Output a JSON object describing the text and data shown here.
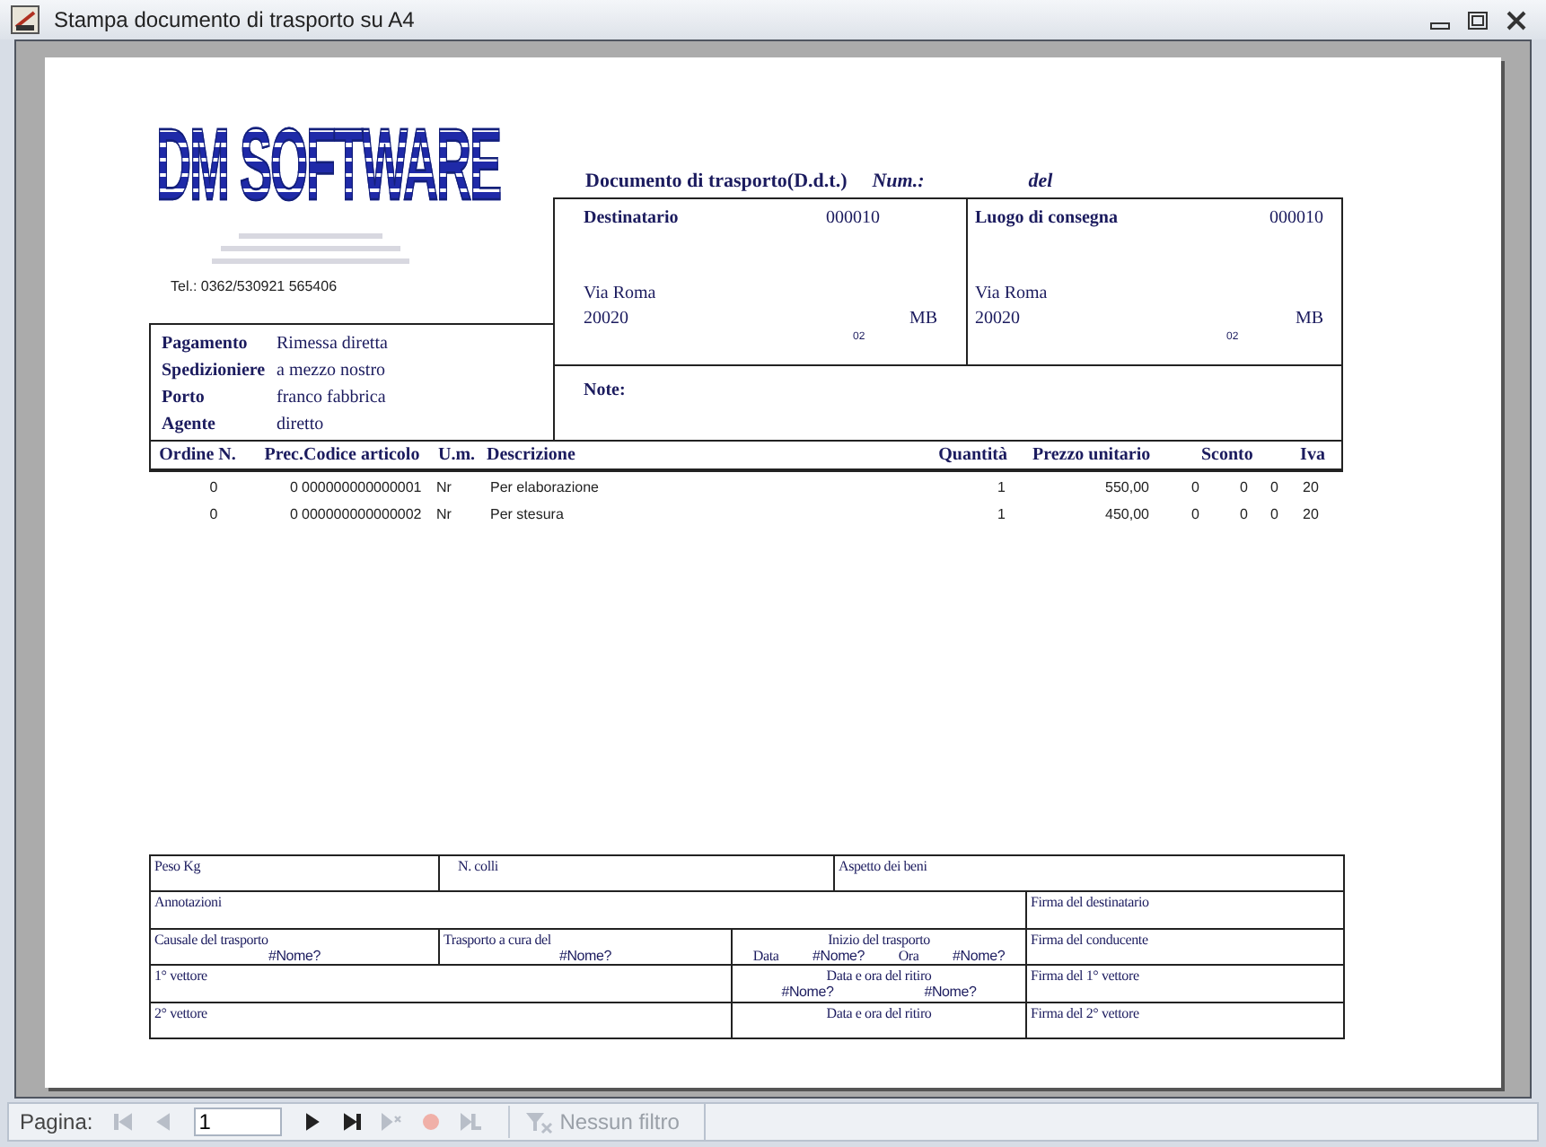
{
  "window": {
    "title": "Stampa documento di trasporto su A4"
  },
  "report": {
    "logo": {
      "name": "DM SOFTWARE",
      "phone": "Tel.: 0362/530921 565406"
    },
    "heading": {
      "title": "Documento di trasporto(D.d.t.)",
      "number_label": "Num.:",
      "date_label": "del"
    },
    "addresses": [
      {
        "label": "Destinatario",
        "code": "000010",
        "street": "Via Roma",
        "zip": "20020",
        "province": "MB",
        "extra": "02"
      },
      {
        "label": "Luogo di consegna",
        "code": "000010",
        "street": "Via Roma",
        "zip": "20020",
        "province": "MB",
        "extra": "02"
      }
    ],
    "terms": [
      {
        "label": "Pagamento",
        "value": "Rimessa diretta"
      },
      {
        "label": "Spedizioniere",
        "value": "a mezzo nostro"
      },
      {
        "label": "Porto",
        "value": "franco fabbrica"
      },
      {
        "label": "Agente",
        "value": "diretto"
      }
    ],
    "notes_label": "Note:",
    "items": {
      "columns": [
        "Ordine N.",
        "Prec.",
        "Codice articolo",
        "U.m.",
        "Descrizione",
        "Quantità",
        "Prezzo unitario",
        "",
        "Sconto",
        "",
        "Iva"
      ],
      "rows": [
        [
          "0",
          "0",
          "000000000000001",
          "Nr",
          "Per elaborazione",
          "1",
          "550,00",
          "0",
          "0",
          "0",
          "20"
        ],
        [
          "0",
          "0",
          "000000000000002",
          "Nr",
          "Per stesura",
          "1",
          "450,00",
          "0",
          "0",
          "0",
          "20"
        ]
      ]
    },
    "shipping_box": {
      "rows": [
        [
          {
            "label": "Peso Kg"
          },
          {
            "label": "N. colli",
            "colspan": 2
          },
          {
            "label": "Aspetto dei beni",
            "colspan": 2
          }
        ],
        [
          {
            "label": "Annotazioni",
            "colspan": 4
          },
          {
            "label": "Firma del destinatario"
          }
        ],
        [
          {
            "label": "Causale del trasporto",
            "values": [
              {
                "text": "#Nome?",
                "kind": "value"
              }
            ]
          },
          {
            "label": "Trasporto a cura del",
            "values": [
              {
                "text": "#Nome?",
                "kind": "value"
              }
            ]
          },
          {
            "label": "Inizio del trasporto",
            "colspan": 2,
            "values": [
              {
                "text": "Data",
                "kind": "label"
              },
              {
                "text": "#Nome?",
                "kind": "value"
              },
              {
                "text": "Ora",
                "kind": "label"
              },
              {
                "text": "#Nome?",
                "kind": "value"
              }
            ]
          },
          {
            "label": "Firma del conducente"
          }
        ],
        [
          {
            "label": "1° vettore",
            "colspan": 2
          },
          {
            "label": "Data e ora del ritiro",
            "colspan": 2,
            "values": [
              {
                "text": "#Nome?",
                "kind": "value"
              },
              {
                "text": "#Nome?",
                "kind": "value"
              }
            ]
          },
          {
            "label": "Firma del 1° vettore"
          }
        ],
        [
          {
            "label": "2° vettore",
            "colspan": 2
          },
          {
            "label": "Data e ora del ritiro",
            "colspan": 2
          },
          {
            "label": "Firma del 2° vettore"
          }
        ]
      ]
    }
  },
  "navigation": {
    "label": "Pagina:",
    "page": "1",
    "buttons": [
      {
        "kind": "first",
        "disabled": true
      },
      {
        "kind": "previous",
        "disabled": true
      },
      {
        "kind": "next",
        "disabled": false
      },
      {
        "kind": "last",
        "disabled": false
      },
      {
        "kind": "new",
        "disabled": true
      },
      {
        "kind": "delete",
        "disabled": true
      },
      {
        "kind": "end",
        "disabled": true
      }
    ],
    "filter": {
      "label": "Nessun filtro",
      "disabled": true
    }
  }
}
